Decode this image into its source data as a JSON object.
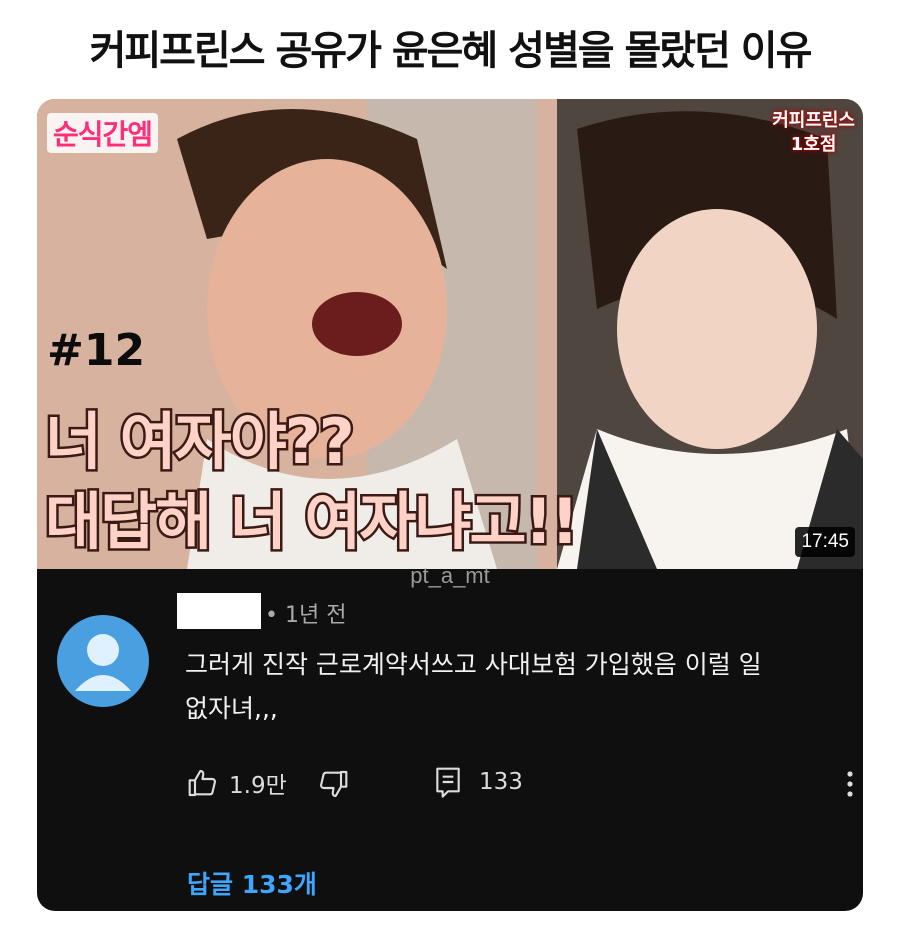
{
  "headline": "커피프린스 공유가 윤은혜 성별을 몰랐던 이유",
  "video": {
    "channel_tag": "순식간엠",
    "logo_text_line1": "커피프린스",
    "logo_text_line2": "1호점",
    "episode": "#12",
    "title_line1": "너 여자야??",
    "title_line2": "대답해 너 여자냐고!!",
    "duration": "17:45"
  },
  "watermark": "pt_a_mt",
  "comment": {
    "meta": "• 1년 전",
    "text": "그러게 진작 근로계약서쓰고 사대보험 가입했음 이럴 일 없자녀,,,",
    "like_count": "1.9만",
    "reply_count": "133",
    "replies_link": "답글 133개"
  },
  "colors": {
    "card_bg": "#0f0f0f",
    "link_blue": "#3ea6ff",
    "avatar_blue": "#4a9fe0"
  }
}
